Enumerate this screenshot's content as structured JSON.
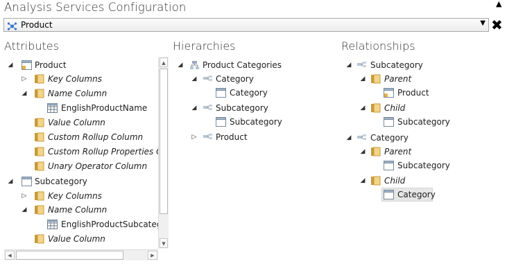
{
  "window": {
    "title": "Analysis Services Configuration"
  },
  "dimension_select": {
    "value": "Product"
  },
  "columns": {
    "attributes": "Attributes",
    "hierarchies": "Hierarchies",
    "relationships": "Relationships"
  },
  "attributes_tree": [
    {
      "label": "Product"
    },
    {
      "label": "Key Columns"
    },
    {
      "label": "Name Column"
    },
    {
      "label": "EnglishProductName"
    },
    {
      "label": "Value Column"
    },
    {
      "label": "Custom Rollup Column"
    },
    {
      "label": "Custom Rollup Properties Colu"
    },
    {
      "label": "Unary Operator Column"
    },
    {
      "label": "Subcategory"
    },
    {
      "label": "Key Columns"
    },
    {
      "label": "Name Column"
    },
    {
      "label": "EnglishProductSubcategor"
    },
    {
      "label": "Value Column"
    }
  ],
  "hierarchies_tree": [
    {
      "label": "Product Categories"
    },
    {
      "label": "Category"
    },
    {
      "label": "Category"
    },
    {
      "label": "Subcategory"
    },
    {
      "label": "Subcategory"
    },
    {
      "label": "Product"
    }
  ],
  "relationships_tree": [
    {
      "label": "Subcategory"
    },
    {
      "label": "Parent"
    },
    {
      "label": "Product"
    },
    {
      "label": "Child"
    },
    {
      "label": "Subcategory"
    },
    {
      "label": "Category"
    },
    {
      "label": "Parent"
    },
    {
      "label": "Subcategory"
    },
    {
      "label": "Child"
    },
    {
      "label": "Category"
    }
  ]
}
